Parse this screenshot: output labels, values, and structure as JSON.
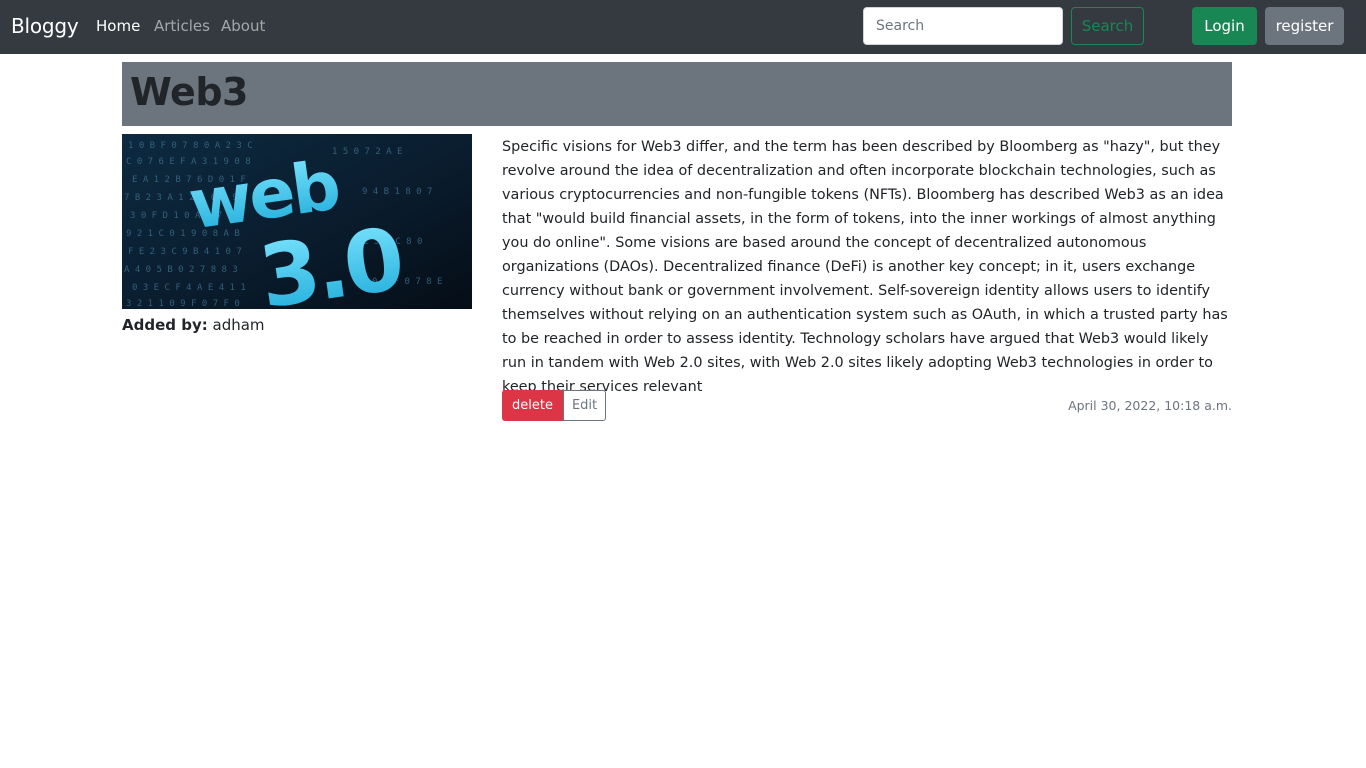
{
  "nav": {
    "brand": "Bloggy",
    "links": [
      "Home",
      "Articles",
      "About"
    ],
    "search_placeholder": "Search",
    "search_button": "Search",
    "login": "Login",
    "register": "register"
  },
  "article": {
    "title": "Web3",
    "image_alt": "web 3.0",
    "added_by_label": "Added by:",
    "author": "adham",
    "body": "Specific visions for Web3 differ, and the term has been described by Bloomberg as \"hazy\", but they revolve around the idea of decentralization and often incorporate blockchain technologies, such as various cryptocurrencies and non-fungible tokens (NFTs). Bloomberg has described Web3 as an idea that \"would build financial assets, in the form of tokens, into the inner workings of almost anything you do online\". Some visions are based around the concept of decentralized autonomous organizations (DAOs). Decentralized finance (DeFi) is another key concept; in it, users exchange currency without bank or government involvement. Self-sovereign identity allows users to identify themselves without relying on an authentication system such as OAuth, in which a trusted party has to be reached in order to assess identity. Technology scholars have argued that Web3 would likely run in tandem with Web 2.0 sites, with Web 2.0 sites likely adopting Web3 technologies in order to keep their services relevant",
    "delete_label": "delete",
    "edit_label": "Edit",
    "timestamp": "April 30, 2022, 10:18 a.m."
  },
  "colors": {
    "navbar": "#343a40",
    "title_bar": "#6c757d",
    "success": "#198754",
    "danger": "#dc3545",
    "secondary": "#6c757d"
  }
}
